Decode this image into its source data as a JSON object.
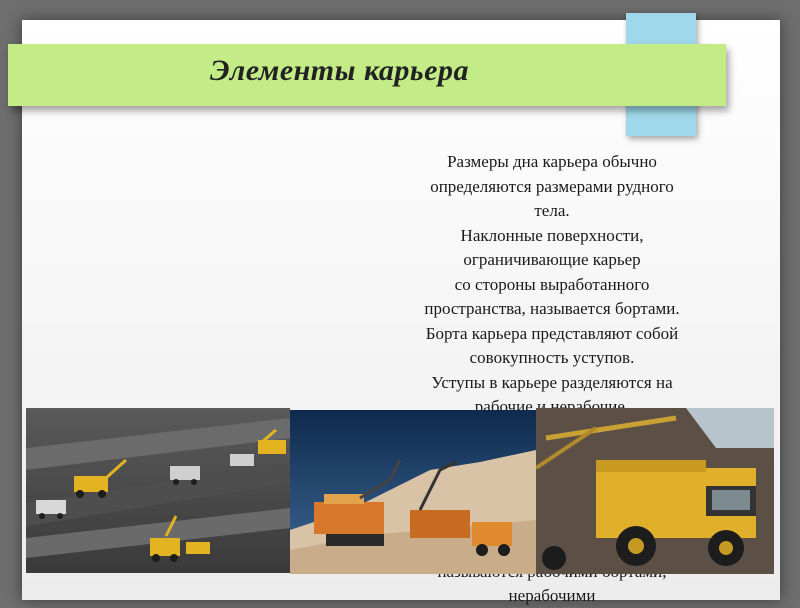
{
  "slide": {
    "title": "Элементы карьера",
    "body_lines": [
      "Размеры дна карьера обычно",
      "определяются размерами рудного",
      "тела.",
      "Наклонные поверхности,",
      "ограничивающие карьер",
      "со стороны выработанного",
      "пространства, называется бортами.",
      "Борта карьера представляют собой",
      "совокупность уступов.",
      "Уступы в карьере разделяются на",
      "рабочие и нерабочие."
    ],
    "trailing_lines": [
      "называются рабочими бортами,",
      "нерабочими"
    ]
  },
  "colors": {
    "title_banner": "#c4ec86",
    "blue_tab": "#9fd8ea",
    "background": "#6e6e6e"
  }
}
